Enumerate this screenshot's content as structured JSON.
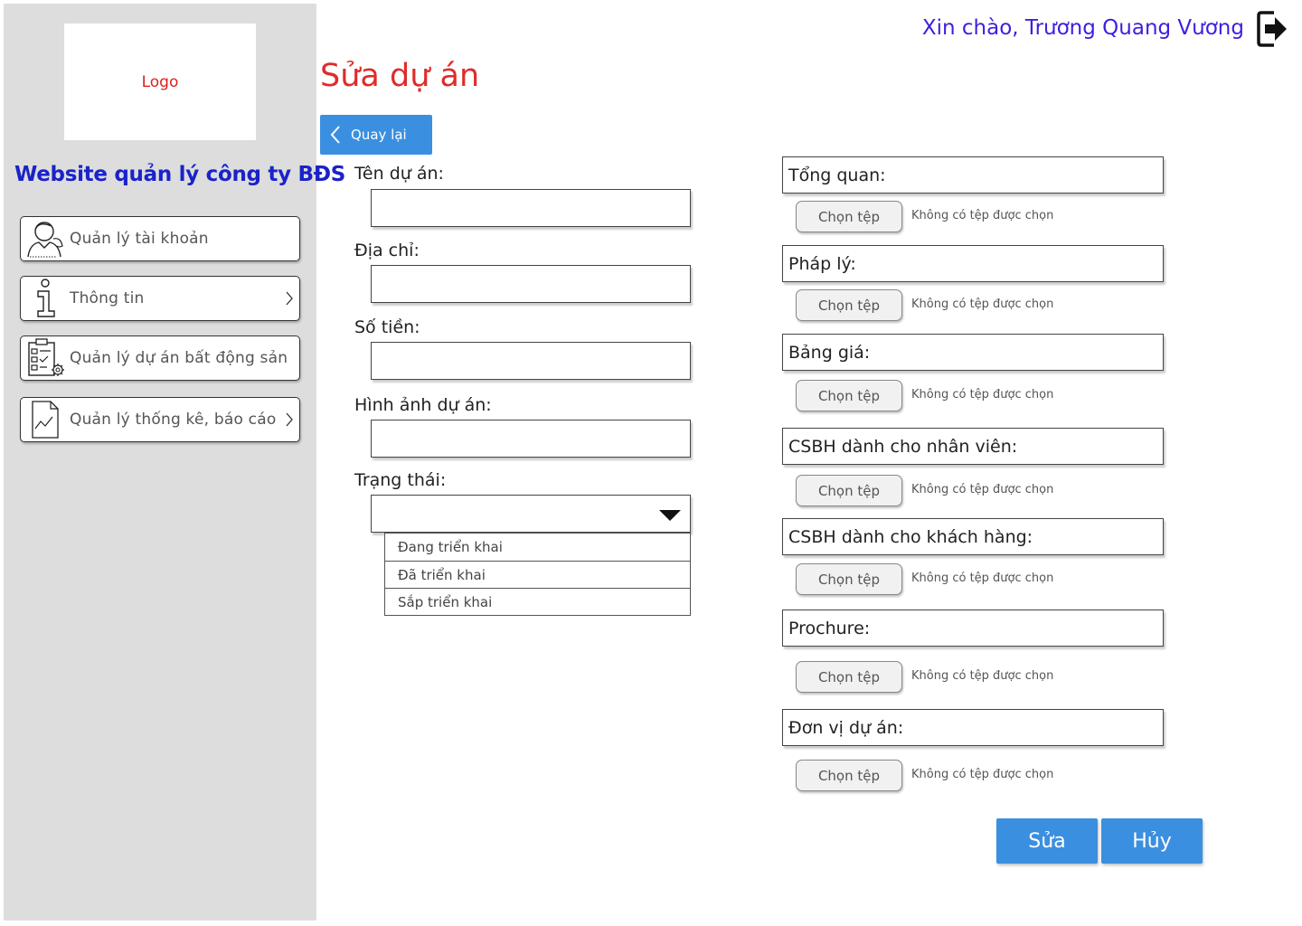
{
  "sidebar": {
    "logo_text": "Logo",
    "site_title": "Website quản lý công ty BĐS",
    "items": [
      {
        "label": "Quản lý tài khoản",
        "icon": "user-manage-icon"
      },
      {
        "label": "Thông tin",
        "icon": "info-icon"
      },
      {
        "label": "Quản lý dự án bất động sản",
        "icon": "checklist-gear-icon"
      },
      {
        "label": "Quản lý thống kê, báo cáo",
        "icon": "chart-report-icon"
      }
    ]
  },
  "header": {
    "greeting": "Xin chào, Trương Quang Vương",
    "logout_icon": "logout-icon"
  },
  "main": {
    "title": "Sửa dự án",
    "back_label": "Quay lại",
    "fields": {
      "name_label": "Tên dự án:",
      "address_label": "Địa chỉ:",
      "amount_label": "Số tiền:",
      "image_label": "Hình ảnh dự án:",
      "status_label": "Trạng thái:"
    },
    "status_options": [
      "Đang triển khai",
      "Đã triển khai",
      "Sắp triển khai"
    ],
    "file_fields": [
      {
        "label": "Tổng quan:",
        "button": "Chọn tệp",
        "status": "Không có tệp được chọn"
      },
      {
        "label": "Pháp lý:",
        "button": "Chọn tệp",
        "status": "Không có tệp được chọn"
      },
      {
        "label": "Bảng giá:",
        "button": "Chọn tệp",
        "status": "Không có tệp được chọn"
      },
      {
        "label": "CSBH dành cho nhân viên:",
        "button": "Chọn tệp",
        "status": "Không có tệp được chọn"
      },
      {
        "label": "CSBH dành cho khách hàng:",
        "button": "Chọn tệp",
        "status": "Không có tệp được chọn"
      },
      {
        "label": "Prochure:",
        "button": "Chọn tệp",
        "status": "Không có tệp được chọn"
      },
      {
        "label": "Đơn vị dự án:",
        "button": "Chọn tệp",
        "status": "Không có tệp được chọn"
      }
    ],
    "edit_label": "Sửa",
    "cancel_label": "Hủy"
  },
  "colors": {
    "sidebar_bg": "#dddddd",
    "accent_blue": "#3b8fe0",
    "title_red": "#e02b2b",
    "greeting_purple": "#3d1fe0",
    "site_title_blue": "#1a22c9"
  }
}
